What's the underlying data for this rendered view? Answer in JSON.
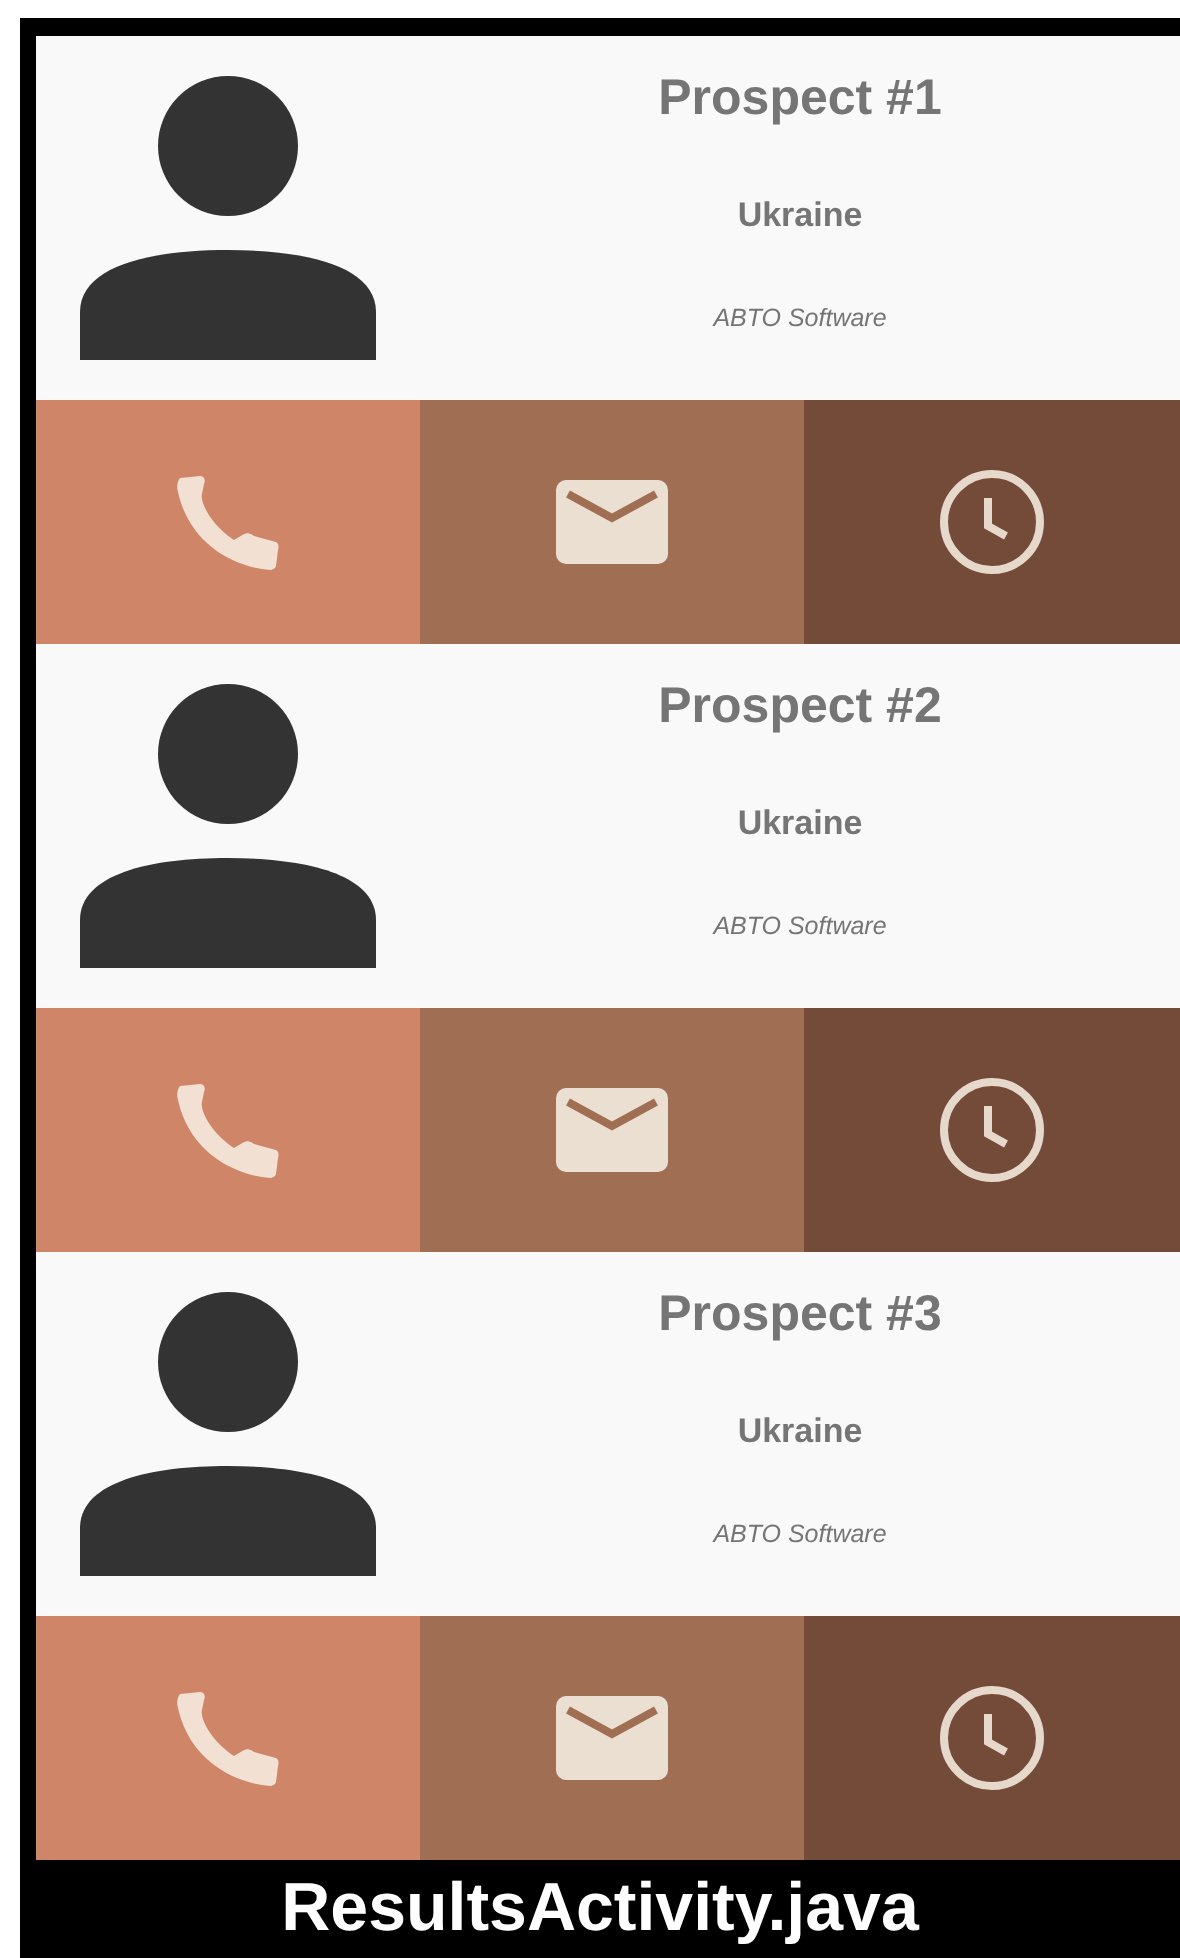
{
  "prospects": [
    {
      "name": "Prospect #1",
      "country": "Ukraine",
      "company": "ABTO Software",
      "actions": [
        {
          "kind": "call",
          "color": "#ce8568"
        },
        {
          "kind": "email",
          "color": "#a06e53"
        },
        {
          "kind": "history",
          "color": "#744a38"
        }
      ]
    },
    {
      "name": "Prospect #2",
      "country": "Ukraine",
      "company": "ABTO Software",
      "actions": [
        {
          "kind": "call",
          "color": "#ce8568"
        },
        {
          "kind": "email",
          "color": "#a06e53"
        },
        {
          "kind": "history",
          "color": "#744a38"
        }
      ]
    },
    {
      "name": "Prospect #3",
      "country": "Ukraine",
      "company": "ABTO Software",
      "actions": [
        {
          "kind": "call",
          "color": "#ce8568"
        },
        {
          "kind": "email",
          "color": "#a06e53"
        },
        {
          "kind": "history",
          "color": "#744a38"
        }
      ]
    }
  ],
  "caption": "ResultsActivity.java"
}
